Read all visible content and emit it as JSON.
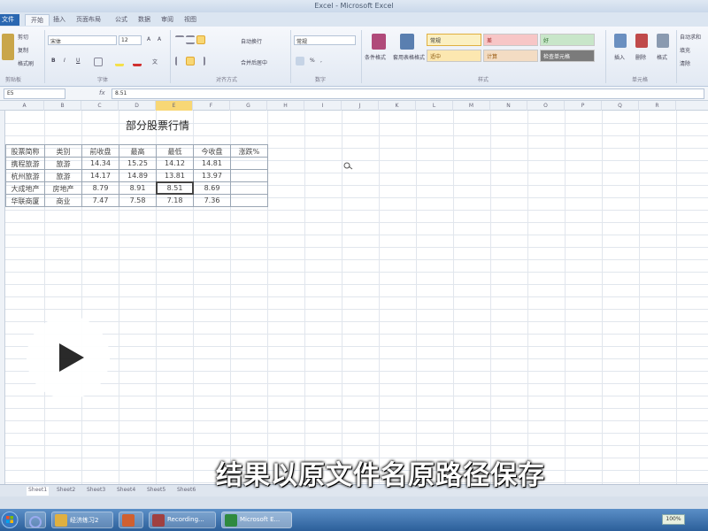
{
  "window": {
    "title": "Excel - Microsoft Excel"
  },
  "ribbon_tabs": [
    "文件",
    "开始",
    "插入",
    "页面布局",
    "公式",
    "数据",
    "审阅",
    "视图"
  ],
  "ribbon": {
    "clipboard": {
      "cut": "剪切",
      "copy": "复制",
      "painter": "格式刷",
      "label": "剪贴板"
    },
    "font": {
      "name": "宋体",
      "size": "12",
      "bold": "B",
      "italic": "I",
      "underline": "U",
      "label": "字体"
    },
    "alignment": {
      "wrap": "自动换行",
      "merge": "合并后居中",
      "label": "对齐方式"
    },
    "number": {
      "format": "常规",
      "label": "数字"
    },
    "styles": {
      "cond": "条件格式",
      "table": "套用表格格式",
      "items": [
        {
          "label": "常规",
          "bg": "#fbf0c2"
        },
        {
          "label": "差",
          "bg": "#f7c6c6"
        },
        {
          "label": "好",
          "bg": "#c8e6c9"
        },
        {
          "label": "适中",
          "bg": "#fce7b0"
        },
        {
          "label": "计算",
          "bg": "#f3dcc3"
        },
        {
          "label": "检查单元格",
          "bg": "#7b7b7b"
        }
      ],
      "label": "样式"
    },
    "cells": {
      "insert": "插入",
      "delete": "删除",
      "format": "格式",
      "label": "单元格"
    },
    "editing": {
      "autosum": "自动求和",
      "fill": "填充",
      "clear": "清除"
    }
  },
  "formula_bar": {
    "cell": "E5",
    "fx": "fx",
    "value": "8.51"
  },
  "columns": [
    "A",
    "B",
    "C",
    "D",
    "E",
    "F",
    "G",
    "H",
    "I",
    "J",
    "K",
    "L",
    "M",
    "N",
    "O",
    "P",
    "Q",
    "R"
  ],
  "selected_column": "E",
  "sheet": {
    "title": "部分股票行情",
    "headers": [
      "股票简称",
      "类别",
      "前收盘",
      "最高",
      "最低",
      "今收盘",
      "涨跌%"
    ],
    "rows": [
      [
        "携程旅游",
        "旅游",
        "14.34",
        "15.25",
        "14.12",
        "14.81",
        ""
      ],
      [
        "杭州旅游",
        "旅游",
        "14.17",
        "14.89",
        "13.81",
        "13.97",
        ""
      ],
      [
        "大成地产",
        "房地产",
        "8.79",
        "8.91",
        "8.51",
        "8.69",
        ""
      ],
      [
        "华联商厦",
        "商业",
        "7.47",
        "7.58",
        "7.18",
        "7.36",
        ""
      ]
    ]
  },
  "sheet_tabs": [
    "Sheet1",
    "Sheet2",
    "Sheet3",
    "Sheet4",
    "Sheet5",
    "Sheet6"
  ],
  "taskbar": {
    "items": [
      {
        "label": "经济练习2",
        "color": "#e0b040"
      },
      {
        "label": "",
        "color": "#d06030"
      },
      {
        "label": "Recording...",
        "color": "#a04040"
      },
      {
        "label": "Microsoft E...",
        "color": "#2f8a3f"
      }
    ],
    "zoom": "100%"
  },
  "overlay": {
    "subtitle": "结果以原文件名原路径保存"
  }
}
